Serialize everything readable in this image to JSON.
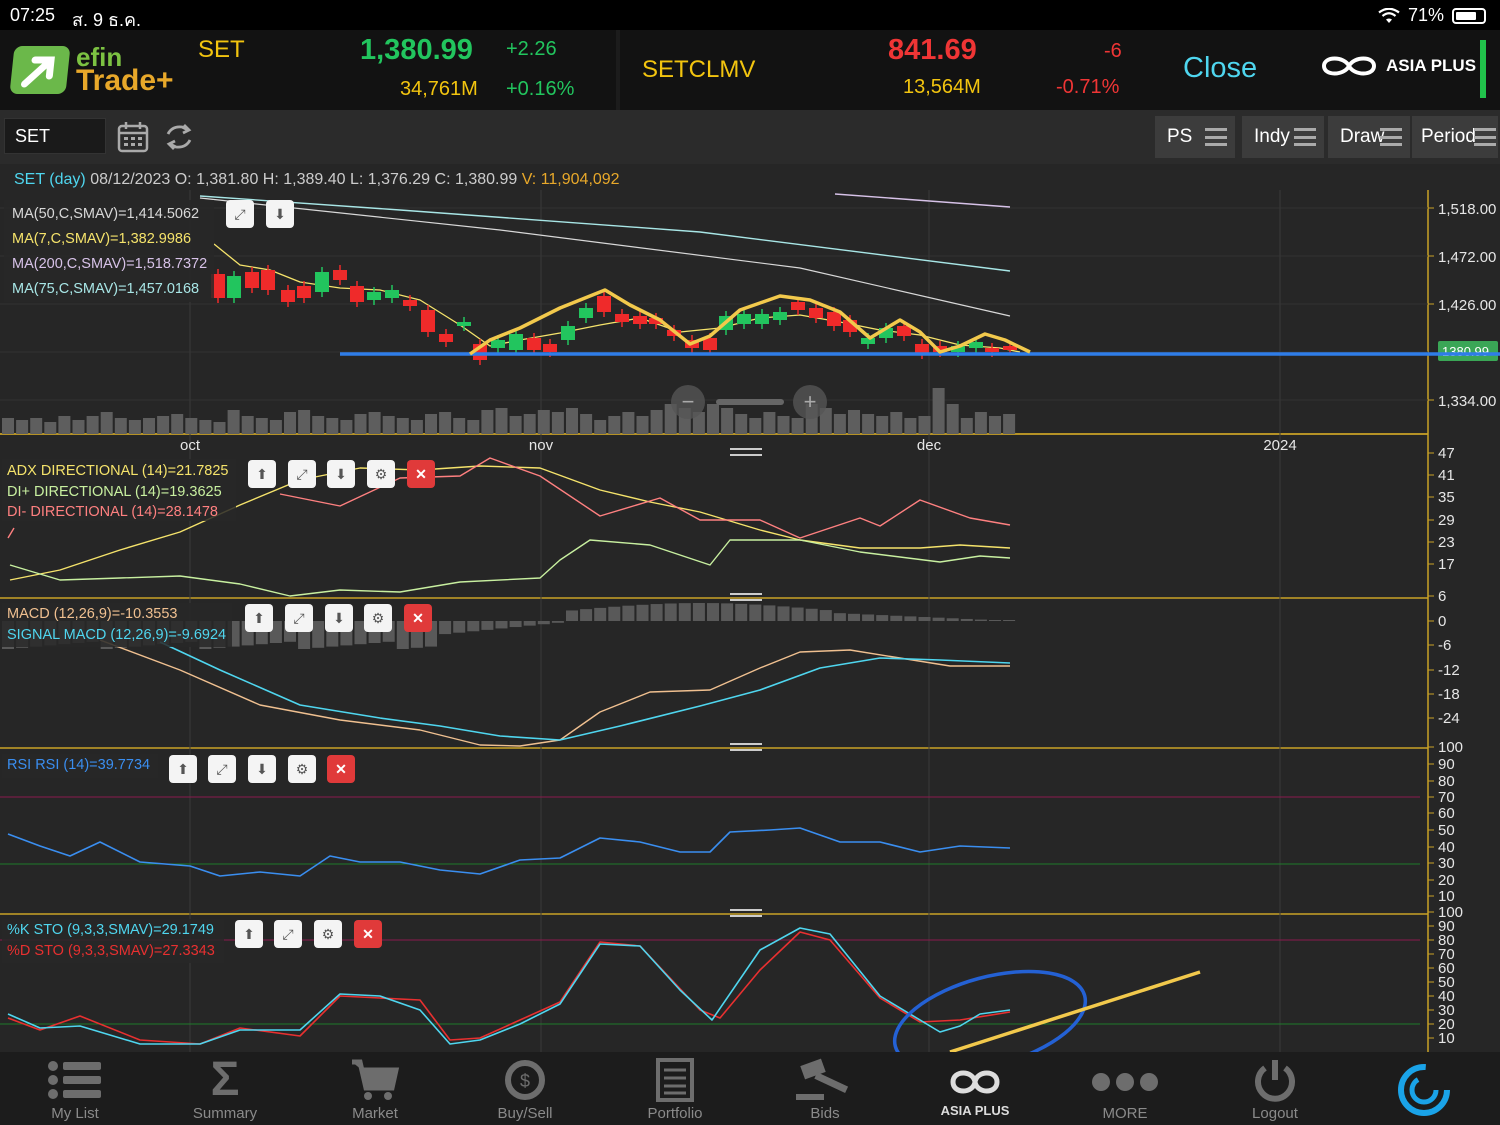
{
  "status": {
    "time": "07:25",
    "date": "ส. 9 ธ.ค.",
    "battery": "71%"
  },
  "header": {
    "logo_top": "efin",
    "logo_bottom": "Trade+",
    "index1": {
      "name": "SET",
      "price": "1,380.99",
      "change": "+2.26",
      "volume": "34,761M",
      "pct": "+0.16%"
    },
    "index2": {
      "name": "SETCLMV",
      "price": "841.69",
      "change": "-6",
      "volume": "13,564M",
      "pct": "-0.71%"
    },
    "market_state": "Close",
    "broker": "ASIA PLUS"
  },
  "toolbar": {
    "symbol": "SET",
    "buttons": [
      "PS",
      "Indy",
      "Draw",
      "Period"
    ]
  },
  "ohlc": {
    "label": "SET (day)",
    "date": "08/12/2023",
    "o_label": "O:",
    "o": "1,381.80",
    "h_label": "H:",
    "h": "1,389.40",
    "l_label": "L:",
    "l": "1,376.29",
    "c_label": "C:",
    "c": "1,380.99",
    "v_label": "V:",
    "v": "11,904,092"
  },
  "price_legend": [
    {
      "text": "MA(50,C,SMAV)=1,414.5062",
      "color": "#d8d8d8"
    },
    {
      "text": "MA(7,C,SMAV)=1,382.9986",
      "color": "#f5e36b"
    },
    {
      "text": "MA(200,C,SMAV)=1,518.7372",
      "color": "#d7c2e8"
    },
    {
      "text": "MA(75,C,SMAV)=1,457.0168",
      "color": "#a8e6e6"
    }
  ],
  "adx_legend": [
    {
      "text": "ADX DIRECTIONAL (14)=21.7825",
      "color": "#f5e36b"
    },
    {
      "text": "DI+ DIRECTIONAL (14)=19.3625",
      "color": "#c8f0a0"
    },
    {
      "text": "DI- DIRECTIONAL (14)=28.1478",
      "color": "#ff8080"
    }
  ],
  "macd_legend": [
    {
      "text": "MACD (12,26,9)=-10.3553",
      "color": "#f0c090"
    },
    {
      "text": "SIGNAL MACD (12,26,9)=-9.6924",
      "color": "#4fd6ef"
    }
  ],
  "rsi_legend": [
    {
      "text": "RSI RSI (14)=39.7734",
      "color": "#3a8ef0"
    }
  ],
  "sto_legend": [
    {
      "text": "%K STO (9,3,3,SMAV)=29.1749",
      "color": "#4fd6ef"
    },
    {
      "text": "%D STO (9,3,3,SMAV)=27.3343",
      "color": "#e83030"
    }
  ],
  "price_axis": [
    "1,518.00",
    "1,472.00",
    "1,426.00",
    "1,334.00"
  ],
  "current_price_tag": "1380.99",
  "date_axis": [
    "oct",
    "nov",
    "dec",
    "2024"
  ],
  "adx_axis": [
    "47",
    "41",
    "35",
    "29",
    "23",
    "17"
  ],
  "macd_axis": [
    "6",
    "0",
    "-6",
    "-12",
    "-18",
    "-24"
  ],
  "rsi_axis": [
    "100",
    "90",
    "80",
    "70",
    "60",
    "50",
    "40",
    "30",
    "20",
    "10"
  ],
  "sto_axis": [
    "100",
    "90",
    "80",
    "70",
    "60",
    "50",
    "40",
    "30",
    "20",
    "10"
  ],
  "colors": {
    "up": "#22c55e",
    "down": "#ef2a2a",
    "support": "#2f7de8",
    "annotation": "#f2c94c"
  },
  "nav": [
    {
      "label": "My List",
      "icon": "list-icon"
    },
    {
      "label": "Summary",
      "icon": "sigma-icon"
    },
    {
      "label": "Market",
      "icon": "cart-icon"
    },
    {
      "label": "Buy/Sell",
      "icon": "exchange-icon"
    },
    {
      "label": "Portfolio",
      "icon": "portfolio-icon"
    },
    {
      "label": "Bids",
      "icon": "gavel-icon"
    },
    {
      "label": "ASIA PLUS",
      "icon": "asiaplus-icon"
    },
    {
      "label": "MORE",
      "icon": "more-icon"
    },
    {
      "label": "Logout",
      "icon": "power-icon"
    }
  ]
}
